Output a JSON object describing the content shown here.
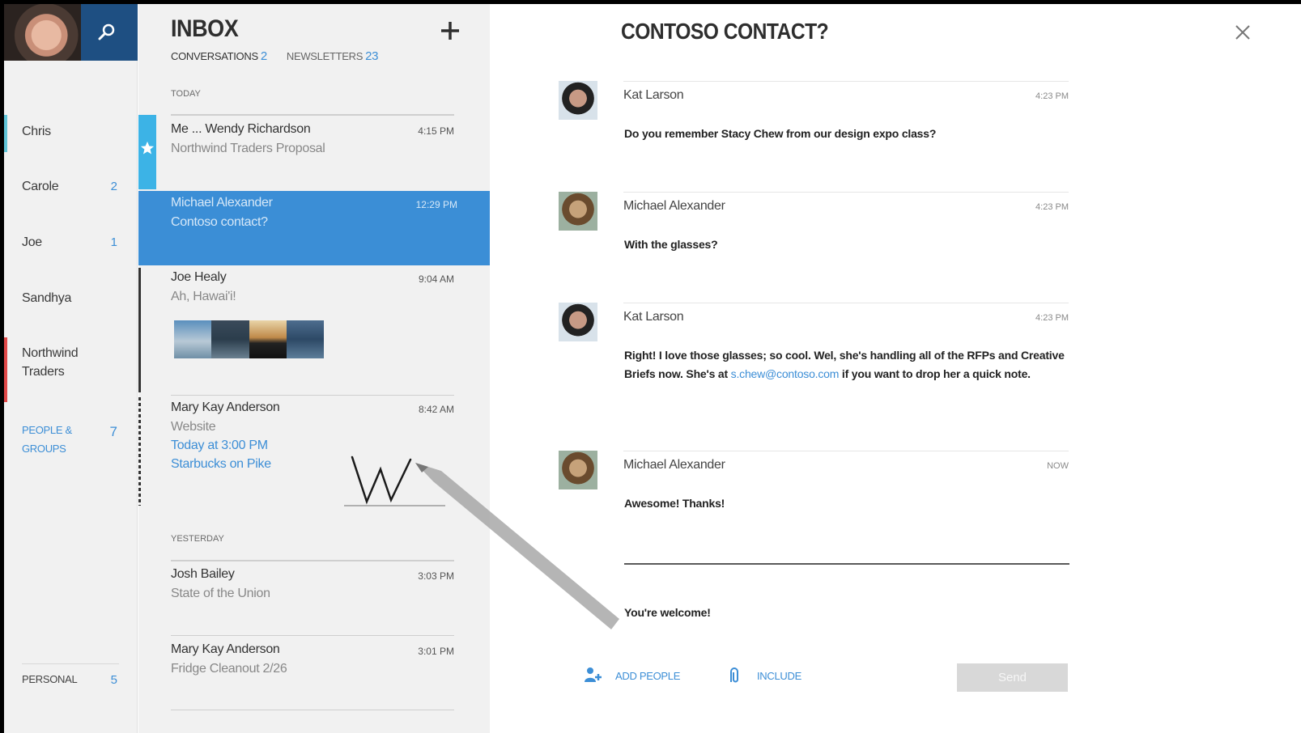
{
  "nav": {
    "items": [
      {
        "label": "Chris",
        "count": "",
        "accent": "#5fc4d8"
      },
      {
        "label": "Carole",
        "count": "2",
        "accent": ""
      },
      {
        "label": "Joe",
        "count": "1",
        "accent": ""
      },
      {
        "label": "Sandhya",
        "count": "",
        "accent": ""
      },
      {
        "label_line1": "Northwind",
        "label_line2": "Traders",
        "count": "",
        "accent": "#e04848"
      }
    ],
    "groups": {
      "line1": "PEOPLE &",
      "line2": "GROUPS",
      "count": "7"
    },
    "personal": {
      "label": "PERSONAL",
      "count": "5"
    }
  },
  "list": {
    "title": "INBOX",
    "tabs": [
      {
        "label": "CONVERSATIONS",
        "count": "2"
      },
      {
        "label": "NEWSLETTERS",
        "count": "23"
      }
    ],
    "groups": {
      "today": "TODAY",
      "yesterday": "YESTERDAY"
    },
    "messages": [
      {
        "from": "Me ... Wendy Richardson",
        "subject": "Northwind Traders Proposal",
        "time": "4:15 PM"
      },
      {
        "from": "Michael Alexander",
        "subject": "Contoso contact?",
        "time": "12:29 PM"
      },
      {
        "from": "Joe Healy",
        "subject": "Ah, Hawai'i!",
        "time": "9:04 AM"
      },
      {
        "from": "Mary Kay Anderson",
        "subject": "Website",
        "time": "8:42 AM",
        "event_time": "Today at 3:00 PM",
        "event_place": "Starbucks on Pike"
      },
      {
        "from": "Josh Bailey",
        "subject": "State of the Union",
        "time": "3:03 PM"
      },
      {
        "from": "Mary Kay Anderson",
        "subject": "Fridge Cleanout 2/26",
        "time": "3:01 PM"
      }
    ]
  },
  "pane": {
    "title": "CONTOSO CONTACT?",
    "posts": [
      {
        "name": "Kat Larson",
        "time": "4:23 PM",
        "body": "Do you remember Stacy Chew from our design expo class?"
      },
      {
        "name": "Michael Alexander",
        "time": "4:23 PM",
        "body": "With the glasses?"
      },
      {
        "name": "Kat Larson",
        "time": "4:23 PM",
        "body_pre": "Right!  I love those glasses; so cool.  Wel, she's handling all of the RFPs and Creative Briefs now.  She's at ",
        "email": "s.chew@contoso.com",
        "body_post": " if you want to drop her a quick note."
      },
      {
        "name": "Michael Alexander",
        "time": "NOW",
        "body": "Awesome!  Thanks!"
      }
    ],
    "reply": "You're welcome!",
    "actions": {
      "add_people": "ADD PEOPLE",
      "include": "INCLUDE",
      "send": "Send"
    }
  },
  "colors": {
    "accent": "#3b8ed6",
    "flag": "#3cb3e6",
    "nav_bg": "#f1f1f1"
  }
}
